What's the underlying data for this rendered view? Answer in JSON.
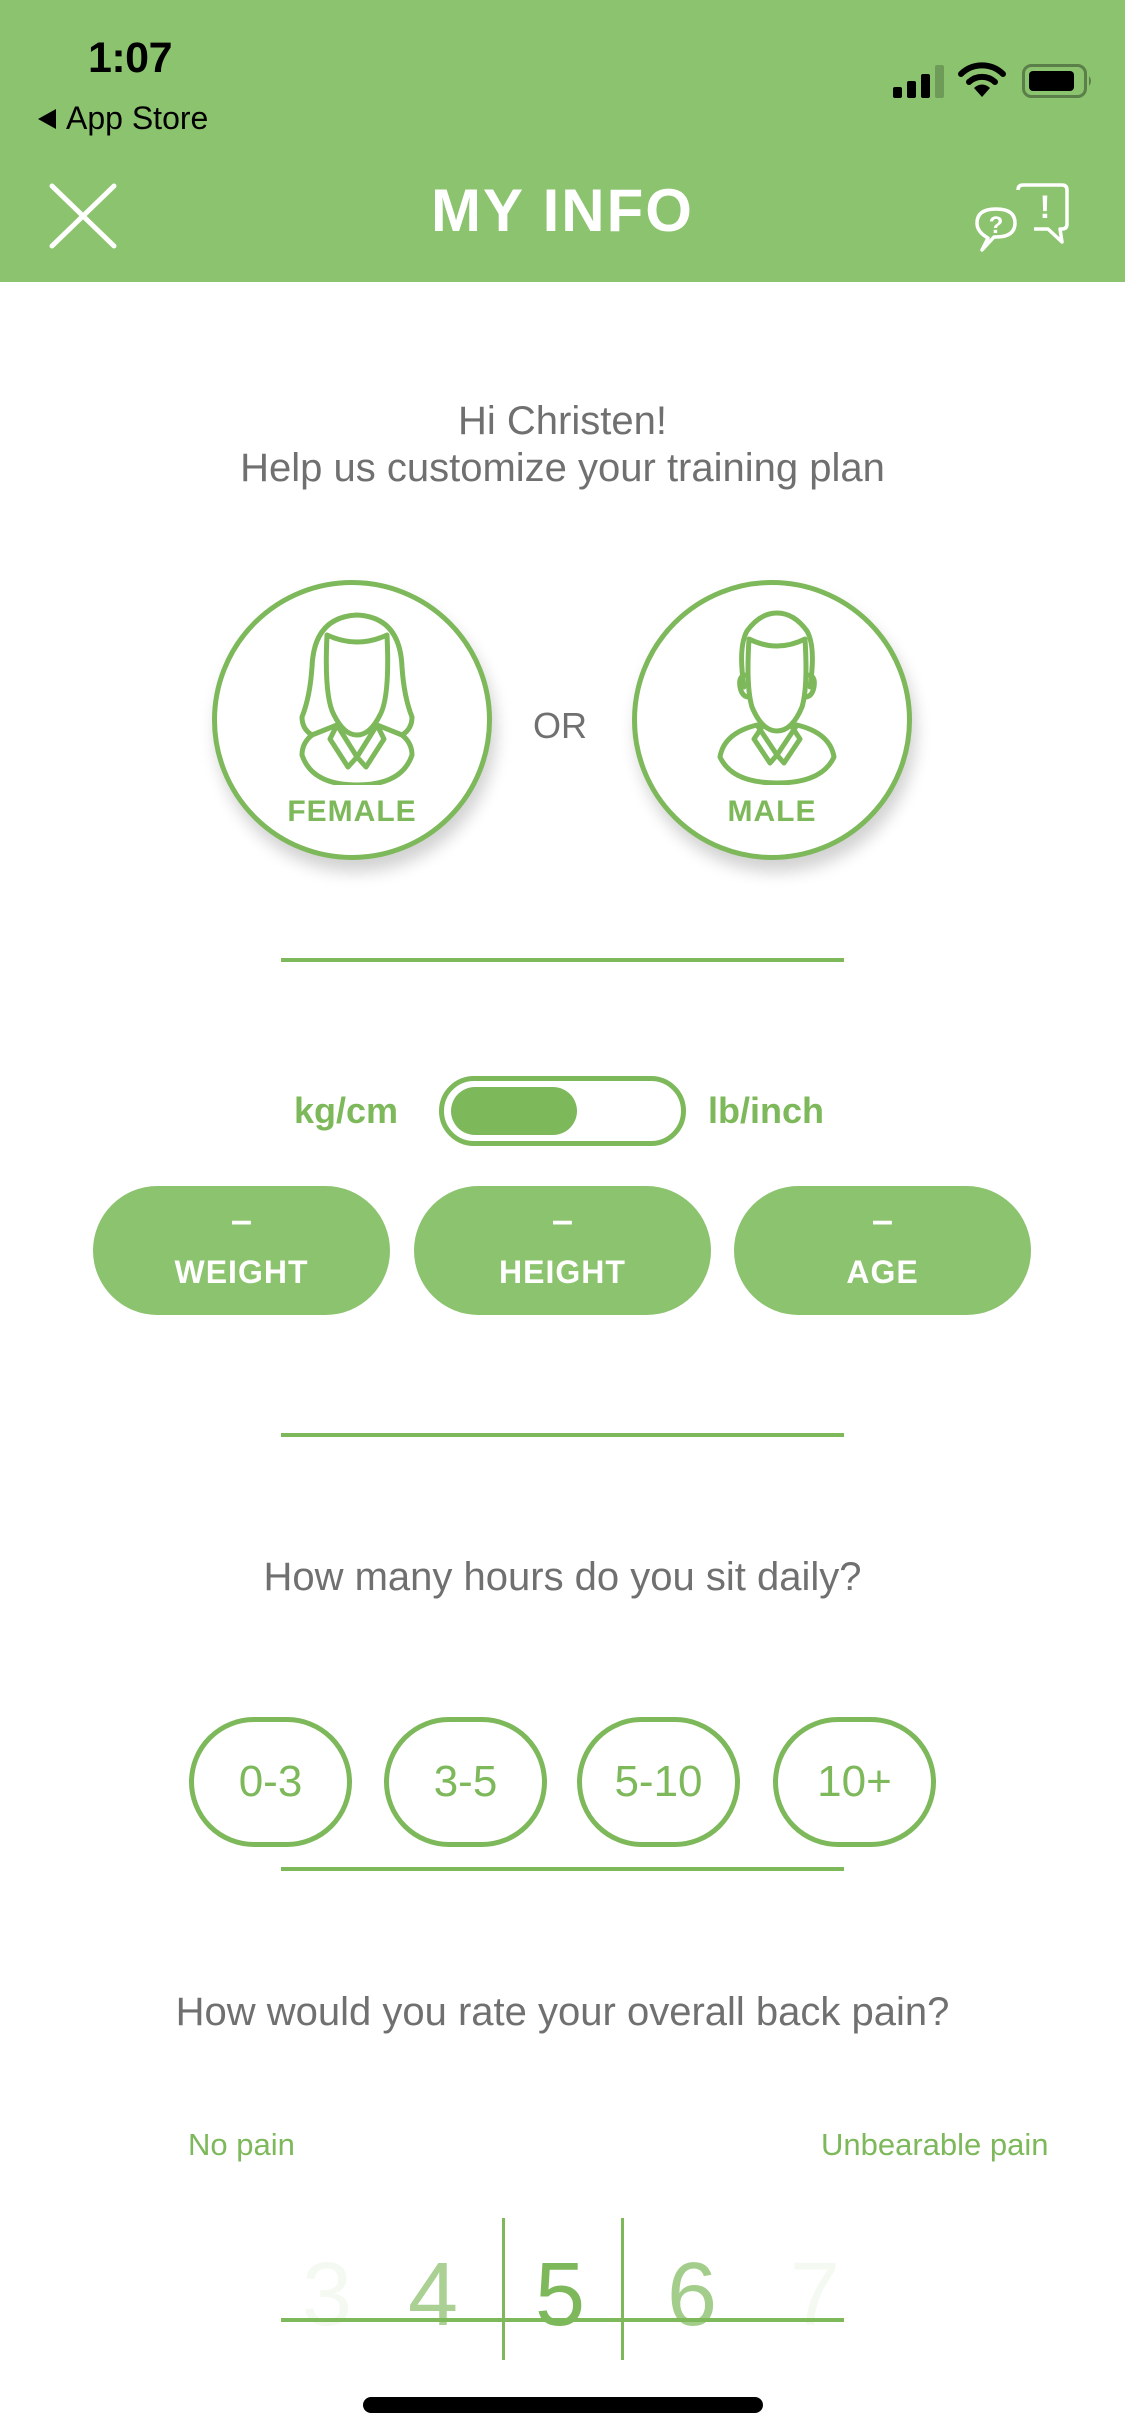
{
  "status_bar": {
    "time": "1:07",
    "back_label": "App Store",
    "signal_bars": 3,
    "signal_bars_total": 4,
    "battery_level_percent": 80
  },
  "header": {
    "title": "MY INFO",
    "close_icon": "close-icon",
    "help_icon": "help-chat-icon",
    "background_color": "#8cc36f"
  },
  "greeting": {
    "line1": "Hi Christen!",
    "line2": "Help us customize your training plan"
  },
  "gender": {
    "options": [
      {
        "label": "FEMALE",
        "icon": "female-avatar-icon"
      },
      {
        "label": "MALE",
        "icon": "male-avatar-icon"
      }
    ],
    "separator": "OR"
  },
  "units": {
    "metric_label": "kg/cm",
    "imperial_label": "lb/inch",
    "selected": "kg/cm"
  },
  "metrics": [
    {
      "value": "–",
      "label": "WEIGHT"
    },
    {
      "value": "–",
      "label": "HEIGHT"
    },
    {
      "value": "–",
      "label": "AGE"
    }
  ],
  "sitting": {
    "question": "How many hours do you sit daily?",
    "options": [
      "0-3",
      "3-5",
      "5-10",
      "10+"
    ]
  },
  "pain": {
    "question": "How would you rate your overall back pain?",
    "min_label": "No pain",
    "max_label": "Unbearable pain",
    "visible_values": [
      "3",
      "4",
      "5",
      "6",
      "7"
    ],
    "selected": "5"
  },
  "colors": {
    "accent": "#7db85a",
    "header": "#8cc36f",
    "text_gray": "#707070"
  }
}
